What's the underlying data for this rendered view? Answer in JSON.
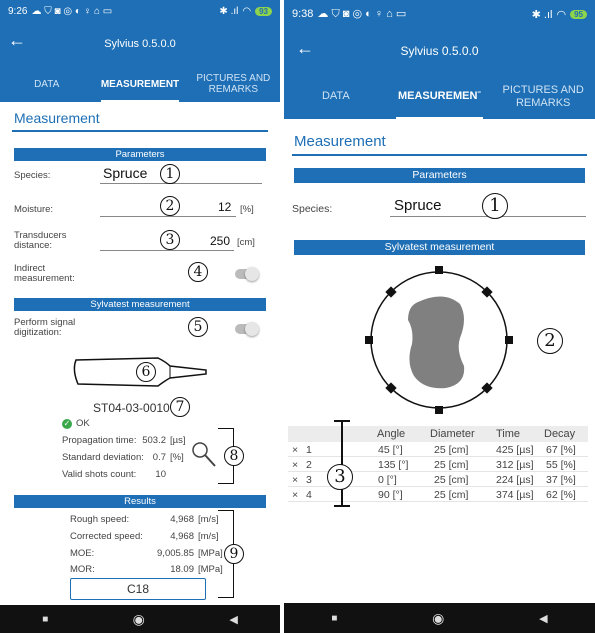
{
  "left": {
    "status_time": "9:26",
    "battery": "93",
    "app_title": "Sylvius 0.5.0.0",
    "tabs": [
      "DATA",
      "MEASUREMENT",
      "PICTURES AND REMARKS"
    ],
    "section_title": "Measurement",
    "params_bar": "Parameters",
    "species_label": "Species:",
    "species_value": "Spruce",
    "moisture_label": "Moisture:",
    "moisture_value": "12",
    "moisture_unit": "[%]",
    "distance_label": "Transducers distance:",
    "distance_value": "250",
    "distance_unit": "[cm]",
    "indirect_label": "Indirect measurement:",
    "sylvatest_bar": "Sylvatest measurement",
    "signal_label": "Perform signal digitization:",
    "device_id": "ST04-03-0010",
    "ok_label": "OK",
    "stats": [
      {
        "label": "Propagation time:",
        "value": "503.2",
        "unit": "[µs]"
      },
      {
        "label": "Standard deviation:",
        "value": "0.7",
        "unit": "[%]"
      },
      {
        "label": "Valid shots count:",
        "value": "10",
        "unit": ""
      }
    ],
    "results_bar": "Results",
    "results": [
      {
        "label": "Rough speed:",
        "value": "4,968",
        "unit": "[m/s]"
      },
      {
        "label": "Corrected speed:",
        "value": "4,968",
        "unit": "[m/s]"
      },
      {
        "label": "MOE:",
        "value": "9,005.85",
        "unit": "[MPa]"
      },
      {
        "label": "MOR:",
        "value": "18.09",
        "unit": "[MPa]"
      }
    ],
    "grade": "C18",
    "callouts": [
      "1",
      "2",
      "3",
      "4",
      "5",
      "6",
      "7",
      "8",
      "9"
    ]
  },
  "right": {
    "status_time": "9:38",
    "battery": "95",
    "app_title": "Sylvius 0.5.0.0",
    "tabs": [
      "DATA",
      "MEASUREMENˉ",
      "PICTURES AND REMARKS"
    ],
    "section_title": "Measurement",
    "params_bar": "Parameters",
    "species_label": "Species:",
    "species_value": "Spruce",
    "sylvatest_bar": "Sylvatest measurement",
    "table_headers": [
      "",
      "",
      "Angle",
      "Diameter",
      "Time",
      "Decay"
    ],
    "table_rows": [
      {
        "x": "×",
        "n": "1",
        "angle": "45 [°]",
        "diameter": "25 [cm]",
        "time": "425 [µs]",
        "decay": "67 [%]"
      },
      {
        "x": "×",
        "n": "2",
        "angle": "135 [°]",
        "diameter": "25 [cm]",
        "time": "312 [µs]",
        "decay": "55 [%]"
      },
      {
        "x": "×",
        "n": "3",
        "angle": "0 [°]",
        "diameter": "25 [cm]",
        "time": "224 [µs]",
        "decay": "37 [%]"
      },
      {
        "x": "×",
        "n": "4",
        "angle": "90 [°]",
        "diameter": "25 [cm]",
        "time": "374 [µs]",
        "decay": "62 [%]"
      }
    ],
    "callouts": [
      "1",
      "2",
      "3"
    ]
  },
  "colors": {
    "primary": "#1e6fb5",
    "ok": "#3aa84a",
    "toggle": "#bbbbbb",
    "navbar": "#111111"
  },
  "icons": [
    "arrow-left-icon",
    "magnifier-icon",
    "check-circle-icon",
    "stop-icon",
    "home-icon",
    "back-triangle-icon",
    "wifi-icon",
    "signal-icon",
    "battery-icon"
  ]
}
